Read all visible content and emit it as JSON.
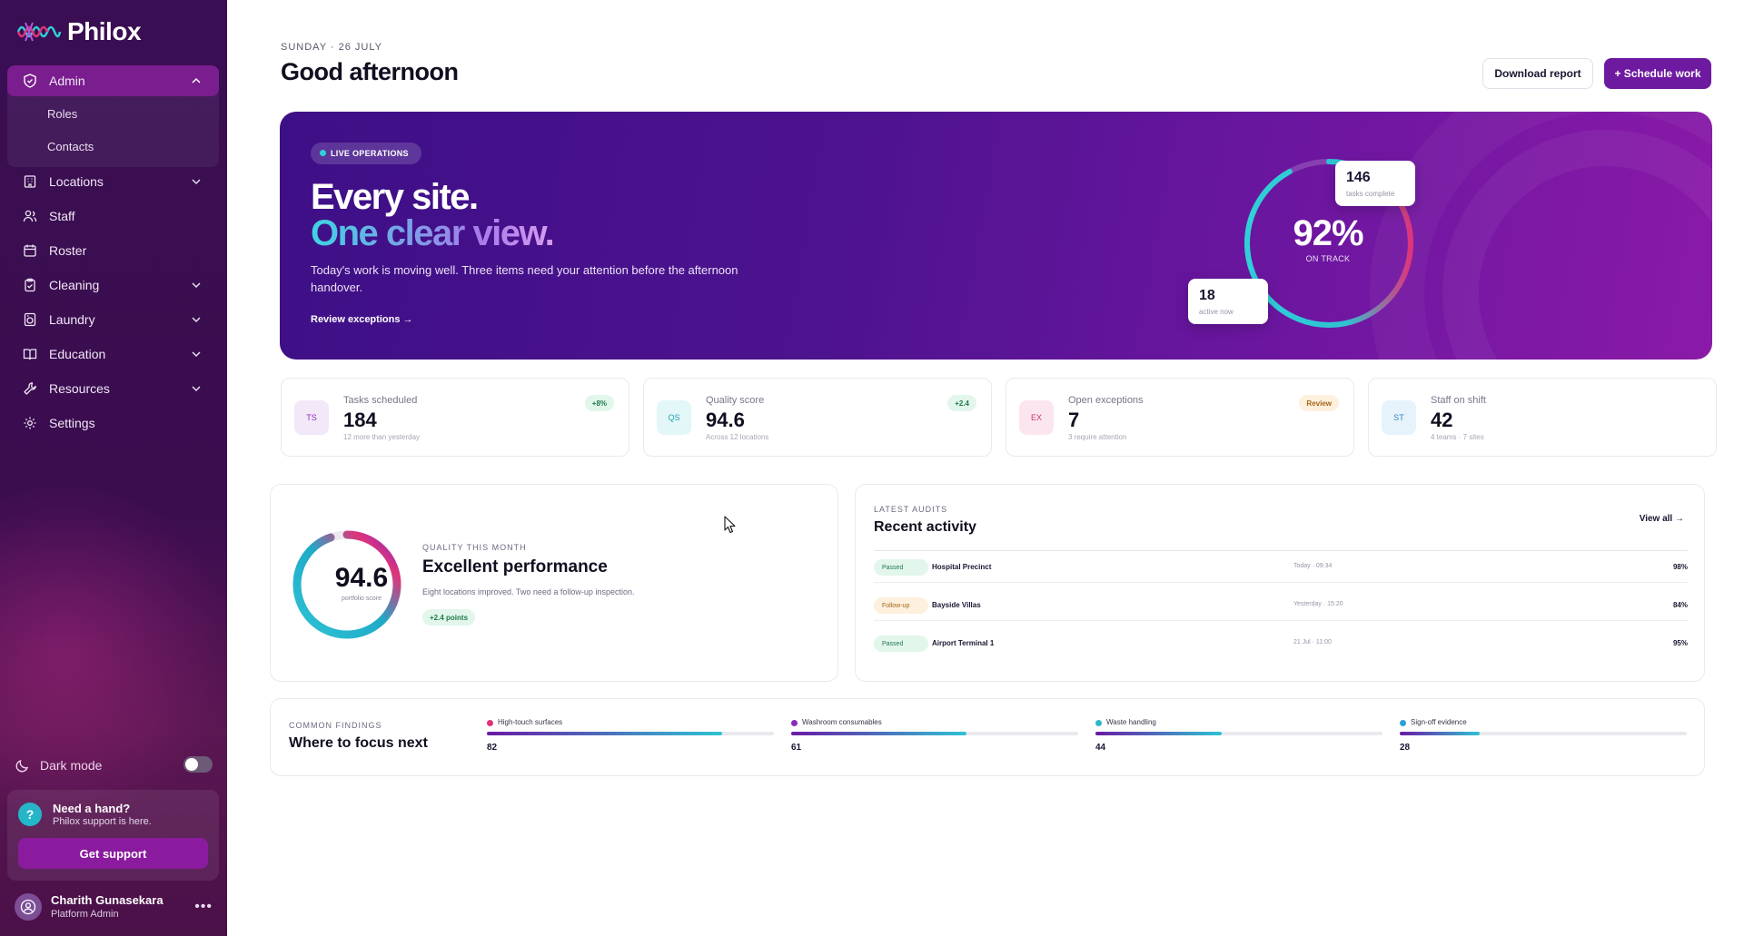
{
  "app": {
    "name": "Philox"
  },
  "sidebar": {
    "admin": {
      "label": "Admin",
      "sub": [
        {
          "label": "Roles"
        },
        {
          "label": "Contacts"
        }
      ]
    },
    "items": [
      {
        "label": "Locations",
        "icon": "building-icon",
        "expandable": true
      },
      {
        "label": "Staff",
        "icon": "users-icon",
        "expandable": false
      },
      {
        "label": "Roster",
        "icon": "calendar-icon",
        "expandable": false
      },
      {
        "label": "Cleaning",
        "icon": "clipboard-icon",
        "expandable": true
      },
      {
        "label": "Laundry",
        "icon": "washer-icon",
        "expandable": true
      },
      {
        "label": "Education",
        "icon": "book-icon",
        "expandable": true
      },
      {
        "label": "Resources",
        "icon": "wrench-icon",
        "expandable": true
      },
      {
        "label": "Settings",
        "icon": "gear-icon",
        "expandable": false
      }
    ],
    "dark_mode_label": "Dark mode",
    "dark_mode_on": false,
    "help": {
      "title": "Need a hand?",
      "subtitle": "Philox support is here.",
      "button": "Get support"
    },
    "user": {
      "name": "Charith Gunasekara",
      "role": "Platform Admin"
    }
  },
  "header": {
    "date": "SUNDAY · 26 JULY",
    "greeting": "Good afternoon",
    "download_label": "Download report",
    "schedule_label": "+ Schedule work"
  },
  "hero": {
    "badge": "LIVE OPERATIONS",
    "line1": "Every site.",
    "line2": "One clear view.",
    "description": "Today's work is moving well. Three items need your attention before the afternoon handover.",
    "link": "Review exceptions →",
    "donut": {
      "value": "92%",
      "label": "ON TRACK",
      "fraction": 0.92
    },
    "tasks_complete": {
      "value": "146",
      "label": "tasks complete"
    },
    "active_now": {
      "value": "18",
      "label": "active now"
    }
  },
  "stats": [
    {
      "abbr": "TS",
      "label": "Tasks scheduled",
      "value": "184",
      "sub": "12 more than yesterday",
      "badge": "+8%",
      "badge_kind": "green"
    },
    {
      "abbr": "QS",
      "label": "Quality score",
      "value": "94.6",
      "sub": "Across 12 locations",
      "badge": "+2.4",
      "badge_kind": "green"
    },
    {
      "abbr": "EX",
      "label": "Open exceptions",
      "value": "7",
      "sub": "3 require attention",
      "badge": "Review",
      "badge_kind": "amber"
    },
    {
      "abbr": "ST",
      "label": "Staff on shift",
      "value": "42",
      "sub": "4 teams · 7 sites",
      "badge": "",
      "badge_kind": "none"
    }
  ],
  "quality": {
    "value": "94.6",
    "value_label": "portfolio score",
    "kicker": "QUALITY THIS MONTH",
    "title": "Excellent performance",
    "description": "Eight locations improved. Two need a follow-up inspection.",
    "badge": "+2.4 points",
    "fraction": 0.946
  },
  "audits": {
    "kicker": "LATEST AUDITS",
    "title": "Recent activity",
    "view_all": "View all →",
    "rows": [
      {
        "status": "Passed",
        "status_kind": "green",
        "name": "Hospital Precinct",
        "time": "Today · 09:34",
        "pct": "98%"
      },
      {
        "status": "Follow-up",
        "status_kind": "amber",
        "name": "Bayside Villas",
        "time": "Yesterday · 15:20",
        "pct": "84%"
      },
      {
        "status": "Passed",
        "status_kind": "green",
        "name": "Airport Terminal 1",
        "time": "21 Jul · 11:00",
        "pct": "95%"
      }
    ]
  },
  "findings": {
    "kicker": "COMMON FINDINGS",
    "title": "Where to focus next",
    "items": [
      {
        "label": "High-touch surfaces",
        "value": "82",
        "fraction": 0.82,
        "dot": "#e0337a"
      },
      {
        "label": "Washroom consumables",
        "value": "61",
        "fraction": 0.61,
        "dot": "#8a2bbf"
      },
      {
        "label": "Waste handling",
        "value": "44",
        "fraction": 0.44,
        "dot": "#2fb6c9"
      },
      {
        "label": "Sign-off evidence",
        "value": "28",
        "fraction": 0.28,
        "dot": "#2f9fd6"
      }
    ]
  }
}
